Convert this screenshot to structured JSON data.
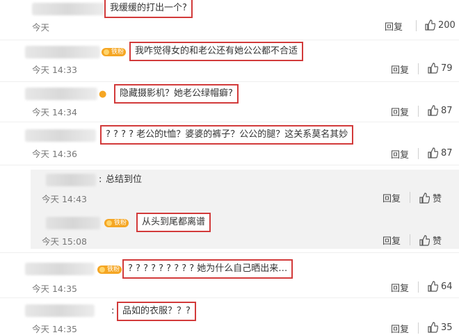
{
  "comments": [
    {
      "text": "我缓缓的打出一个?",
      "time": "今天",
      "reply": "回复",
      "likes": "200",
      "badge": ""
    },
    {
      "text": "我咋觉得女的和老公还有她公公都不合适",
      "time": "今天 14:33",
      "reply": "回复",
      "likes": "79",
      "badge": "铁粉"
    },
    {
      "text": "隐藏摄影机？她老公绿帽癖?",
      "time": "今天 14:34",
      "reply": "回复",
      "likes": "87",
      "badge": ""
    },
    {
      "text": "? ? ? ? 老公的t恤？婆婆的裤子？公公的腿？这关系莫名其妙",
      "time": "今天 14:36",
      "reply": "回复",
      "likes": "87",
      "badge": ""
    },
    {
      "text": "总结到位",
      "time": "今天 14:43",
      "reply": "回复",
      "likes": "赞",
      "badge": ""
    },
    {
      "text": "从头到尾都离谱",
      "time": "今天 15:08",
      "reply": "回复",
      "likes": "赞",
      "badge": "铁粉"
    },
    {
      "text": "? ? ? ? ? ? ? ? ? 她为什么自己晒出来…",
      "time": "今天 14:35",
      "reply": "回复",
      "likes": "64",
      "badge": "铁粉"
    },
    {
      "text": "品如的衣服？？?",
      "time": "今天 14:35",
      "reply": "回复",
      "likes": "35",
      "badge": ""
    }
  ],
  "colors": {
    "highlight_box": "#d23a3a",
    "reply_background": "#f2f2f2",
    "badge": "#f5a623"
  },
  "icons": {
    "like": "thumbs-up-icon",
    "badge": "fan-badge-icon"
  }
}
